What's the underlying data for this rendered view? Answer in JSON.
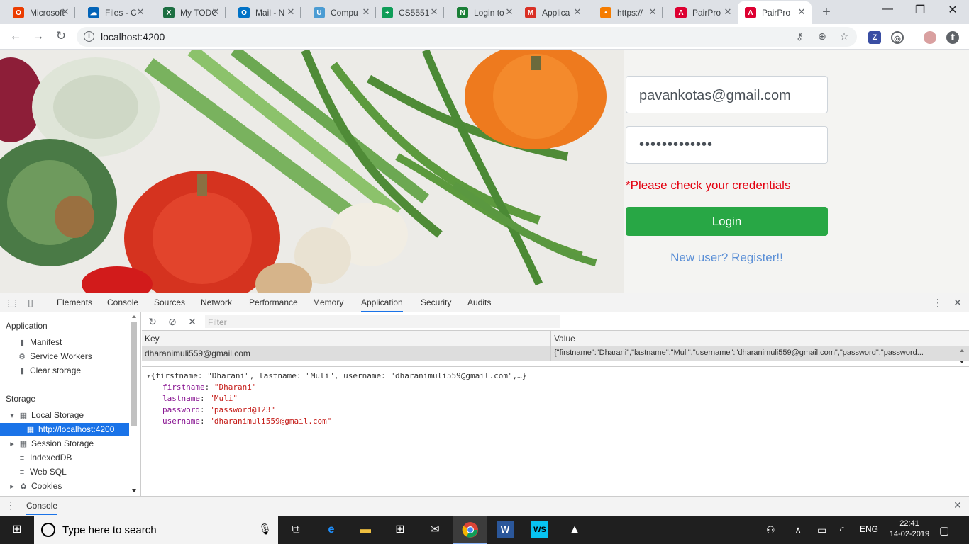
{
  "browser": {
    "tabs": [
      {
        "title": "Microsoft",
        "icon": "office-icon",
        "color": "#eb3c00"
      },
      {
        "title": "Files - C",
        "icon": "onedrive-icon",
        "color": "#0364b8"
      },
      {
        "title": "My TODO",
        "icon": "excel-icon",
        "color": "#1d6f42"
      },
      {
        "title": "Mail - N",
        "icon": "outlook-icon",
        "color": "#0072c6"
      },
      {
        "title": "Compu",
        "icon": "unc-icon",
        "color": "#4b9cd3"
      },
      {
        "title": "CS5551",
        "icon": "sheets-icon",
        "color": "#0f9d58"
      },
      {
        "title": "Login to",
        "icon": "n-icon",
        "color": "#1a7f37"
      },
      {
        "title": "Applica",
        "icon": "gmail-icon",
        "color": "#d93025"
      },
      {
        "title": "https://",
        "icon": "dots-icon",
        "color": "#f57c00"
      },
      {
        "title": "PairPro",
        "icon": "angular-icon",
        "color": "#dd0031"
      },
      {
        "title": "PairPro",
        "icon": "angular-icon",
        "color": "#dd0031"
      }
    ],
    "active_tab_index": 10,
    "url": "localhost:4200",
    "controls": {
      "minimize": "—",
      "restore": "❐",
      "close": "✕"
    }
  },
  "login": {
    "email_value": "pavankotas@gmail.com",
    "password_mask": "•••••••••••••",
    "error": "*Please check your credentials",
    "login_label": "Login",
    "register_label": "New user? Register!!",
    "accent": "#28a745",
    "error_color": "#e3000f"
  },
  "devtools": {
    "tabs": [
      "Elements",
      "Console",
      "Sources",
      "Network",
      "Performance",
      "Memory",
      "Application",
      "Security",
      "Audits"
    ],
    "active_tab": "Application",
    "sidebar": {
      "application_heading": "Application",
      "application_items": [
        "Manifest",
        "Service Workers",
        "Clear storage"
      ],
      "storage_heading": "Storage",
      "local_storage": "Local Storage",
      "local_storage_origin": "http://localhost:4200",
      "storage_items": [
        "Session Storage",
        "IndexedDB",
        "Web SQL",
        "Cookies"
      ]
    },
    "filter_placeholder": "Filter",
    "columns": {
      "key": "Key",
      "value": "Value"
    },
    "row": {
      "key": "dharanimuli559@gmail.com",
      "value": "{\"firstname\":\"Dharani\",\"lastname\":\"Muli\",\"username\":\"dharanimuli559@gmail.com\",\"password\":\"password..."
    },
    "preview": {
      "summary": "{firstname: \"Dharani\", lastname: \"Muli\", username: \"dharanimuli559@gmail.com\",…}",
      "fields": [
        {
          "key": "firstname",
          "value": "\"Dharani\""
        },
        {
          "key": "lastname",
          "value": "\"Muli\""
        },
        {
          "key": "password",
          "value": "\"password@123\""
        },
        {
          "key": "username",
          "value": "\"dharanimuli559@gmail.com\""
        }
      ]
    },
    "drawer_tab": "Console"
  },
  "taskbar": {
    "search_placeholder": "Type here to search",
    "language": "ENG",
    "time": "22:41",
    "date": "14-02-2019"
  }
}
